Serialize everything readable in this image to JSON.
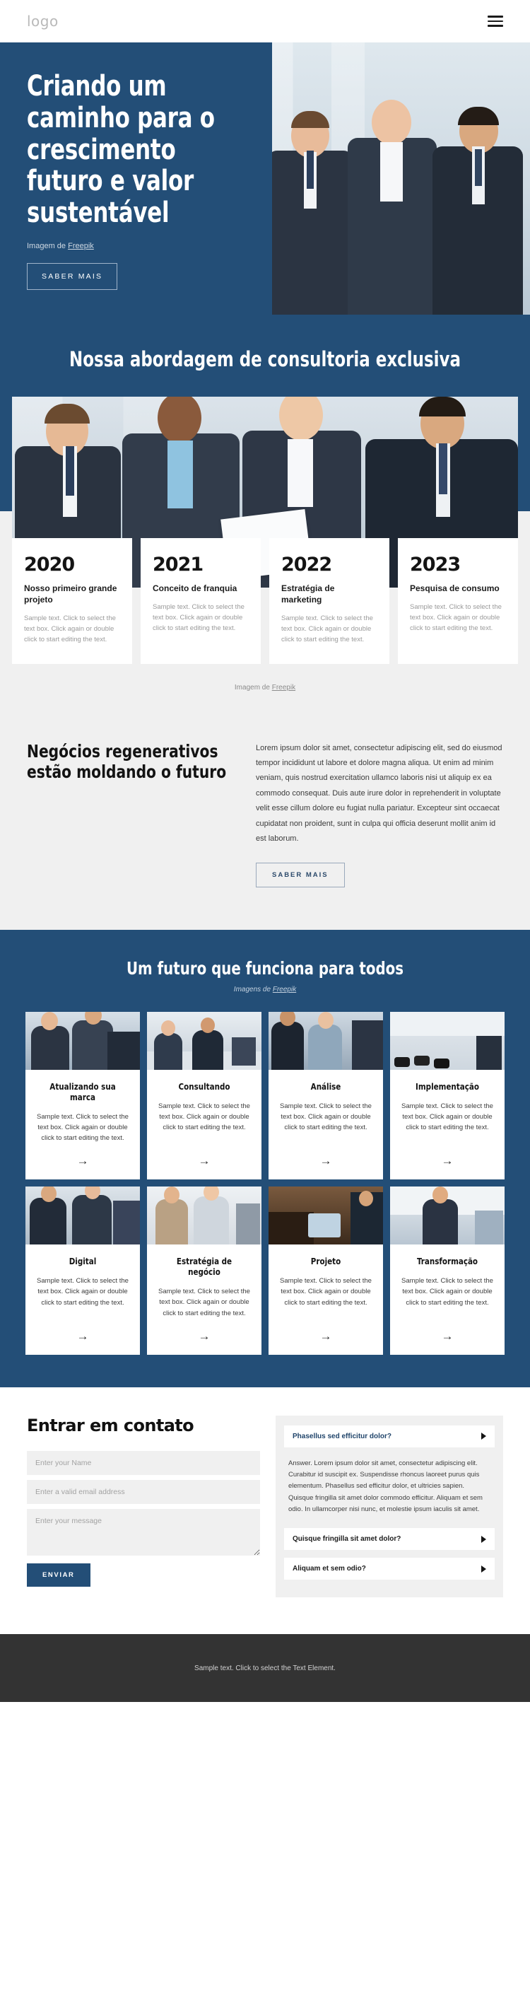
{
  "header": {
    "logo": "logo",
    "menu_icon": "hamburger-menu-icon"
  },
  "hero": {
    "title": "Criando um caminho para o crescimento futuro e valor sustentável",
    "credit_prefix": "Imagem de ",
    "credit_link": "Freepik",
    "cta": "SABER MAIS"
  },
  "approach": {
    "title": "Nossa abordagem de consultoria exclusiva"
  },
  "timeline": {
    "cards": [
      {
        "year": "2020",
        "title": "Nosso primeiro grande projeto",
        "text": "Sample text. Click to select the text box. Click again or double click to start editing the text."
      },
      {
        "year": "2021",
        "title": "Conceito de franquia",
        "text": "Sample text. Click to select the text box. Click again or double click to start editing the text."
      },
      {
        "year": "2022",
        "title": "Estratégia de marketing",
        "text": "Sample text. Click to select the text box. Click again or double click to start editing the text."
      },
      {
        "year": "2023",
        "title": "Pesquisa de consumo",
        "text": "Sample text. Click to select the text box. Click again or double click to start editing the text."
      }
    ],
    "credit_prefix": "Imagem de ",
    "credit_link": "Freepik"
  },
  "regenerative": {
    "title": "Negócios regenerativos estão moldando o futuro",
    "paragraph": "Lorem ipsum dolor sit amet, consectetur adipiscing elit, sed do eiusmod tempor incididunt ut labore et dolore magna aliqua. Ut enim ad minim veniam, quis nostrud exercitation ullamco laboris nisi ut aliquip ex ea commodo consequat. Duis aute irure dolor in reprehenderit in voluptate velit esse cillum dolore eu fugiat nulla pariatur. Excepteur sint occaecat cupidatat non proident, sunt in culpa qui officia deserunt mollit anim id est laborum.",
    "cta": "SABER MAIS"
  },
  "services": {
    "title": "Um futuro que funciona para todos",
    "credit_prefix": "Imagens de ",
    "credit_link": "Freepik",
    "arrow_label": "→",
    "cards": [
      {
        "name": "Atualizando sua marca",
        "text": "Sample text. Click to select the text box. Click again or double click to start editing the text."
      },
      {
        "name": "Consultando",
        "text": "Sample text. Click to select the text box. Click again or double click to start editing the text."
      },
      {
        "name": "Análise",
        "text": "Sample text. Click to select the text box. Click again or double click to start editing the text."
      },
      {
        "name": "Implementação",
        "text": "Sample text. Click to select the text box. Click again or double click to start editing the text."
      },
      {
        "name": "Digital",
        "text": "Sample text. Click to select the text box. Click again or double click to start editing the text."
      },
      {
        "name": "Estratégia de negócio",
        "text": "Sample text. Click to select the text box. Click again or double click to start editing the text."
      },
      {
        "name": "Projeto",
        "text": "Sample text. Click to select the text box. Click again or double click to start editing the text."
      },
      {
        "name": "Transformação",
        "text": "Sample text. Click to select the text box. Click again or double click to start editing the text."
      }
    ]
  },
  "contact": {
    "title": "Entrar em contato",
    "name_placeholder": "Enter your Name",
    "email_placeholder": "Enter a valid email address",
    "message_placeholder": "Enter your message",
    "submit": "ENVIAR",
    "faq": [
      {
        "question": "Phasellus sed efficitur dolor?",
        "answer": "Answer. Lorem ipsum dolor sit amet, consectetur adipiscing elit. Curabitur id suscipit ex. Suspendisse rhoncus laoreet purus quis elementum. Phasellus sed efficitur dolor, et ultricies sapien. Quisque fringilla sit amet dolor commodo efficitur. Aliquam et sem odio. In ullamcorper nisi nunc, et molestie ipsum iaculis sit amet.",
        "open": true
      },
      {
        "question": "Quisque fringilla sit amet dolor?",
        "answer": "",
        "open": false
      },
      {
        "question": "Aliquam et sem odio?",
        "answer": "",
        "open": false
      }
    ]
  },
  "footer": {
    "text": "Sample text. Click to select the Text Element."
  },
  "colors": {
    "brand_blue": "#234e77",
    "light_gray": "#f0f0f0",
    "footer_dark": "#333333"
  }
}
